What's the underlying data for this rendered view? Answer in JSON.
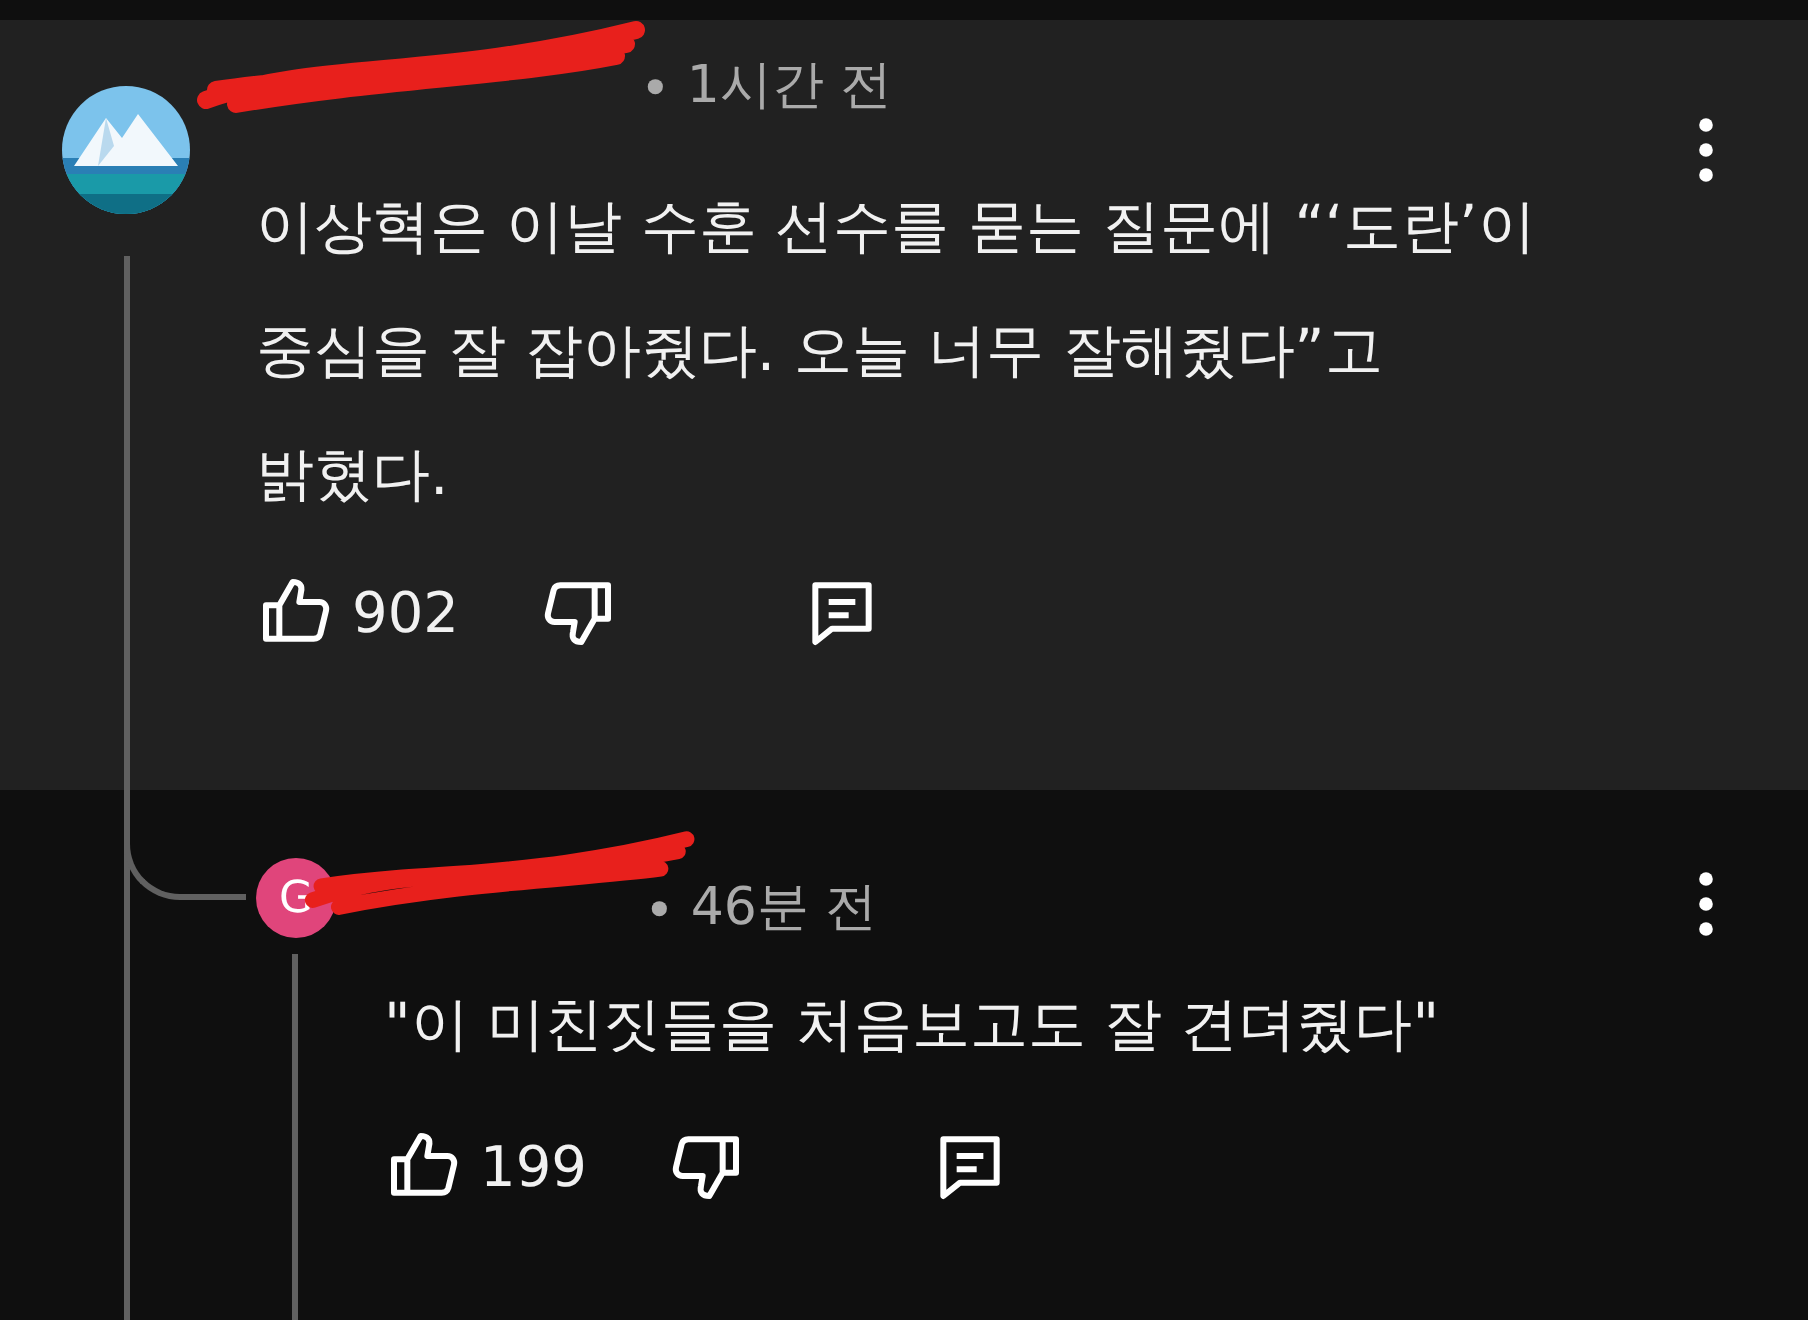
{
  "comment": {
    "author": {
      "redacted": true
    },
    "separator": "•",
    "time": "1시간 전",
    "lines": [
      "이상혁은 이날 수훈 선수를 묻는 질문에 “‘도란’이",
      "중심을 잘 잡아줬다. 오늘 너무 잘해줬다”고",
      "밝혔다."
    ],
    "likes": "902"
  },
  "reply": {
    "author": {
      "redacted": true,
      "initial": "G",
      "color": "#e0457b"
    },
    "separator": "•",
    "time": "46분 전",
    "lines": [
      "\"이 미친짓들을 처음보고도 잘 견뎌줬다\""
    ],
    "likes": "199"
  }
}
